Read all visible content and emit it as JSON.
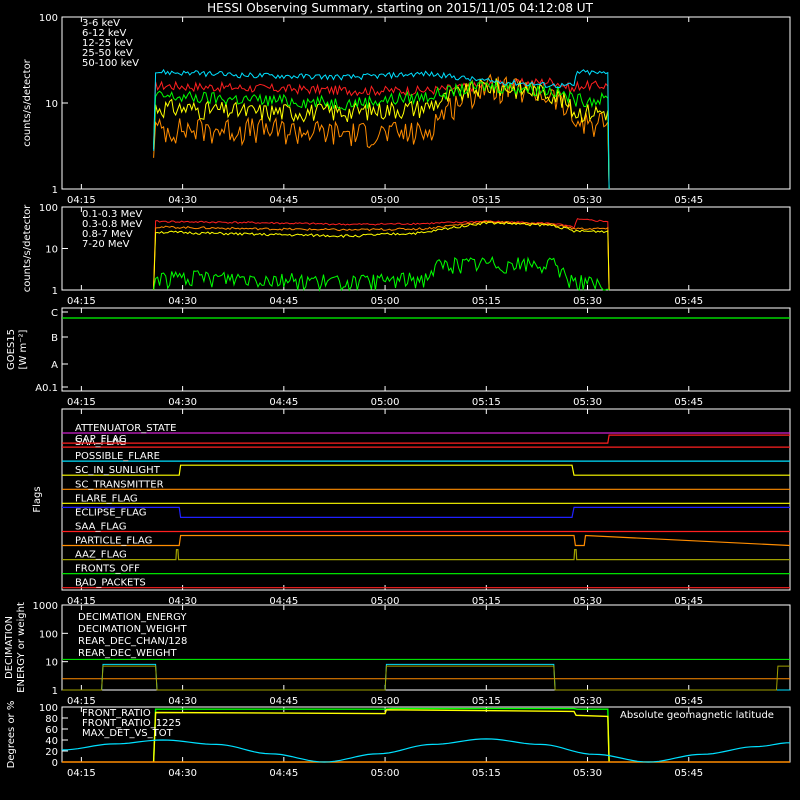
{
  "title": "HESSI Observing Summary, starting on 2015/11/05 04:12:08 UT",
  "x_ticks": [
    "04:15",
    "04:30",
    "04:45",
    "05:00",
    "05:15",
    "05:30",
    "05:45"
  ],
  "x_tick_minutes": [
    15,
    30,
    45,
    60,
    75,
    90,
    105
  ],
  "x_range_minutes": [
    12.13,
    120
  ],
  "colors": {
    "red": "#ff2020",
    "orange": "#ff8c00",
    "yellow": "#ffff00",
    "green": "#00ff00",
    "cyan": "#00e0ff",
    "magenta": "#d020d0",
    "blue": "#2020ff",
    "olive": "#a0a000",
    "white": "#ffffff"
  },
  "chart_data": [
    {
      "type": "line",
      "panel": "lightcurve",
      "ylabel": "counts/s/detector",
      "yscale": "log",
      "ylim": [
        1,
        100
      ],
      "y_ticks": [
        "100",
        "10",
        "1"
      ],
      "series": [
        {
          "name": "3-6 keV",
          "color": "red",
          "x": [
            25.7,
            26,
            40,
            55,
            66,
            75,
            85,
            88,
            88.5,
            93,
            93.2
          ],
          "y": [
            3,
            16,
            15,
            14,
            14,
            16,
            18,
            14,
            16,
            16,
            1
          ]
        },
        {
          "name": "6-12 keV",
          "color": "orange",
          "x": [
            25.7,
            26,
            40,
            55,
            66,
            75,
            85,
            88,
            93,
            93.2
          ],
          "y": [
            3,
            5,
            5,
            4.5,
            4.5,
            16,
            12,
            6,
            6,
            1
          ]
        },
        {
          "name": "12-25 keV",
          "color": "yellow",
          "x": [
            25.7,
            26,
            40,
            55,
            66,
            75,
            85,
            88,
            93,
            93.2
          ],
          "y": [
            3,
            9,
            8,
            8,
            9,
            16,
            13,
            8,
            8,
            1
          ]
        },
        {
          "name": "25-50 keV",
          "color": "green",
          "x": [
            25.7,
            26,
            40,
            55,
            66,
            75,
            85,
            88,
            93,
            93.2
          ],
          "y": [
            3,
            12,
            11,
            10,
            12,
            16,
            14,
            11,
            11,
            1
          ]
        },
        {
          "name": "50-100 keV",
          "color": "cyan",
          "x": [
            25.7,
            26,
            40,
            55,
            66,
            75,
            85,
            88,
            88.5,
            93,
            93.2
          ],
          "y": [
            3,
            23,
            21,
            20,
            22,
            18,
            16,
            16,
            23,
            22,
            1
          ]
        }
      ]
    },
    {
      "type": "line",
      "panel": "lightcurve_mev",
      "ylabel": "counts/s/detector",
      "yscale": "log",
      "ylim": [
        1,
        100
      ],
      "y_ticks": [
        "100",
        "10",
        "1"
      ],
      "series": [
        {
          "name": "0.1-0.3 MeV",
          "color": "red",
          "x": [
            25.7,
            26,
            40,
            55,
            66,
            75,
            85,
            88,
            88.5,
            93,
            93.2
          ],
          "y": [
            1,
            45,
            42,
            38,
            40,
            45,
            40,
            32,
            50,
            45,
            1
          ]
        },
        {
          "name": "0.3-0.8 MeV",
          "color": "orange",
          "x": [
            25.7,
            26,
            40,
            55,
            66,
            75,
            85,
            88,
            93,
            93.2
          ],
          "y": [
            1,
            33,
            30,
            28,
            30,
            44,
            38,
            30,
            30,
            1
          ]
        },
        {
          "name": "0.8-7 MeV",
          "color": "yellow",
          "x": [
            25.7,
            26,
            40,
            55,
            66,
            75,
            85,
            88,
            93,
            93.2
          ],
          "y": [
            1,
            25,
            22,
            20,
            24,
            42,
            36,
            26,
            26,
            1
          ]
        },
        {
          "name": "7-20 MeV",
          "color": "green",
          "x": [
            25.7,
            26,
            40,
            55,
            66,
            68,
            75,
            85,
            87,
            93.2
          ],
          "y": [
            1,
            2,
            2,
            1.5,
            2,
            4,
            4.5,
            4,
            2,
            1
          ]
        }
      ]
    },
    {
      "type": "line",
      "panel": "goes",
      "ylabel": "GOES15",
      "yunits": "[W m⁻²]",
      "y_ticks": [
        "C",
        "B",
        "A",
        "A0.1"
      ],
      "series": [
        {
          "name": "GOES15",
          "color": "green",
          "x": [
            12.13,
            120
          ],
          "y": [
            "C",
            "C"
          ]
        }
      ]
    },
    {
      "type": "line",
      "panel": "flags",
      "ylabel": "Flags",
      "series": [
        {
          "name": "ATTENUATOR_STATE",
          "color": "magenta",
          "x": [
            12.13,
            120
          ],
          "state": [
            0,
            0
          ]
        },
        {
          "name": "SAA_FLAG",
          "color": "red",
          "x": [
            12.13,
            120
          ],
          "state": [
            0,
            0
          ]
        },
        {
          "name": "POSSIBLE_FLARE",
          "color": "cyan",
          "x": [
            12.13,
            120
          ],
          "state": [
            0,
            0
          ]
        },
        {
          "name": "SC_IN_SUNLIGHT",
          "color": "yellow",
          "x": [
            12.13,
            29.5,
            29.7,
            87.7,
            88,
            120
          ],
          "state": [
            0,
            0,
            1,
            1,
            0,
            0
          ]
        },
        {
          "name": "SC_TRANSMITTER",
          "color": "orange",
          "x": [
            12.13,
            120
          ],
          "state": [
            0,
            0
          ]
        },
        {
          "name": "FLARE_FLAG",
          "color": "yellow",
          "x": [
            12.13,
            120
          ],
          "state": [
            0,
            0
          ]
        },
        {
          "name": "ECLIPSE_FLAG",
          "color": "blue",
          "x": [
            12.13,
            29.5,
            29.7,
            87.7,
            88,
            120
          ],
          "state": [
            1,
            1,
            0,
            0,
            1,
            1
          ]
        },
        {
          "name": "SAA_FLAG",
          "color": "red",
          "x": [
            12.13,
            120
          ],
          "state": [
            0,
            0
          ]
        },
        {
          "name": "PARTICLE_FLAG",
          "color": "orange",
          "x": [
            12.13,
            29.5,
            29.7,
            88,
            88.2,
            89.5,
            89.7,
            120
          ],
          "state": [
            0,
            0,
            1,
            1,
            0,
            0,
            1,
            0
          ]
        },
        {
          "name": "AAZ_FLAG",
          "color": "olive",
          "x": [
            12.13,
            29,
            29.1,
            29.3,
            29.4,
            88,
            88.1,
            88.3,
            88.4,
            120
          ],
          "state": [
            0,
            0,
            1,
            1,
            0,
            0,
            1,
            1,
            0,
            0
          ]
        },
        {
          "name": "FRONTS_OFF",
          "color": "green",
          "x": [
            12.13,
            120
          ],
          "state": [
            0,
            0
          ]
        },
        {
          "name": "BAD_PACKETS",
          "color": "red",
          "x": [
            12.13,
            120
          ],
          "state": [
            0,
            0
          ]
        }
      ],
      "gap_flag": {
        "name": "GAP_FLAG",
        "color": "red",
        "x": [
          12.13,
          93,
          93.2,
          120
        ],
        "state": [
          0,
          0,
          1,
          1
        ]
      }
    },
    {
      "type": "line",
      "panel": "decimation",
      "ylabel": "DECIMATION",
      "ylabel2": "ENERGY or weight",
      "yscale": "log",
      "ylim": [
        1,
        1000
      ],
      "y_ticks": [
        "1000",
        "100",
        "10",
        "1"
      ],
      "series": [
        {
          "name": "DECIMATION_ENERGY",
          "color": "green",
          "x": [
            12.13,
            120
          ],
          "y": [
            12,
            12
          ]
        },
        {
          "name": "DECIMATION_WEIGHT",
          "color": "orange",
          "x": [
            12.13,
            120
          ],
          "y": [
            2.5,
            2.5
          ]
        },
        {
          "name": "REAR_DEC_CHAN/128",
          "color": "cyan",
          "x": [
            12.13,
            18,
            18.2,
            26,
            26.2,
            60,
            60.2,
            85,
            85.2,
            120
          ],
          "y": [
            1,
            1,
            8,
            8,
            1,
            1,
            8,
            8,
            1,
            1
          ]
        },
        {
          "name": "REAR_DEC_WEIGHT",
          "color": "olive",
          "x": [
            12.13,
            18,
            18.2,
            26,
            26.2,
            60,
            60.2,
            85,
            85.2,
            118,
            118.2,
            120
          ],
          "y": [
            1,
            1,
            7,
            7,
            1,
            1,
            7,
            7,
            1,
            1,
            7,
            7
          ]
        }
      ]
    },
    {
      "type": "line",
      "panel": "ratios",
      "ylabel": "Degrees or %",
      "ylim": [
        0,
        100
      ],
      "y_ticks": [
        "100",
        "80",
        "60",
        "40",
        "20",
        "0"
      ],
      "series": [
        {
          "name": "FRONT_RATIO",
          "color": "green",
          "x": [
            25.7,
            26,
            60,
            61,
            88,
            88.5,
            93,
            93.2
          ],
          "y": [
            0,
            96,
            96,
            97,
            97,
            96,
            96,
            0
          ]
        },
        {
          "name": "FRONT_RATIO_1225",
          "color": "yellow",
          "x": [
            25.7,
            26,
            60,
            60.2,
            88,
            88.3,
            93,
            93.2
          ],
          "y": [
            0,
            90,
            88,
            95,
            92,
            85,
            83,
            0
          ]
        },
        {
          "name": "MAX_DET_VS_TOT",
          "color": "orange",
          "x": [
            12.13,
            120
          ],
          "y": [
            0,
            0
          ]
        },
        {
          "name": "Absolute geomagnetic latitude",
          "color": "cyan",
          "x": [
            12.13,
            20,
            27,
            35,
            43,
            51,
            59,
            67,
            75,
            83,
            91,
            99,
            107,
            115,
            120
          ],
          "y": [
            22,
            33,
            40,
            32,
            15,
            0,
            15,
            32,
            42,
            32,
            14,
            0,
            14,
            28,
            35
          ]
        }
      ]
    }
  ]
}
